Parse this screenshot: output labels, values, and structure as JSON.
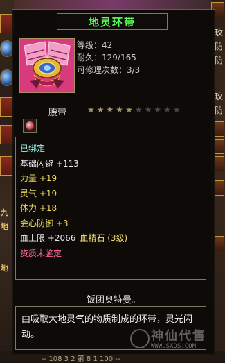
{
  "item": {
    "name": "地灵环带",
    "level": "等级：42",
    "durability": "耐久：129/165",
    "repairs": "可修理次数：3/3",
    "type": "腰带",
    "stars_filled": 5,
    "stars_total": 10
  },
  "stats": {
    "bound": "已绑定",
    "dodge": "基础闪避 +113",
    "strength": "力量 +19",
    "spirit": "灵气 +19",
    "stamina": "体力 +18",
    "crit_def": "会心防御 +3",
    "hp_max": "血上限 +2066",
    "gem": "血精石 (3级)",
    "quality": "资质未鉴定"
  },
  "maker": "饭团奥特曼。",
  "description": "由吸取大地灵气的物质制成的环带，灵光闪动。",
  "watermark": {
    "text": "神仙代售",
    "url": "WWW.SXDS.COM"
  },
  "background": {
    "left_labels": [
      "九",
      "地",
      "地"
    ],
    "right_labels": [
      "玫",
      "防",
      "防",
      "玫",
      "防"
    ],
    "bottom_text": "-- 108 3 2 第 8 1 100 --"
  },
  "colors": {
    "title": "#5cff5c",
    "bound": "#9ef0e8",
    "stat": "#e8d860",
    "quality": "#ff6a9a",
    "star_on": "#a89a70",
    "star_off": "#4a4a4a"
  }
}
